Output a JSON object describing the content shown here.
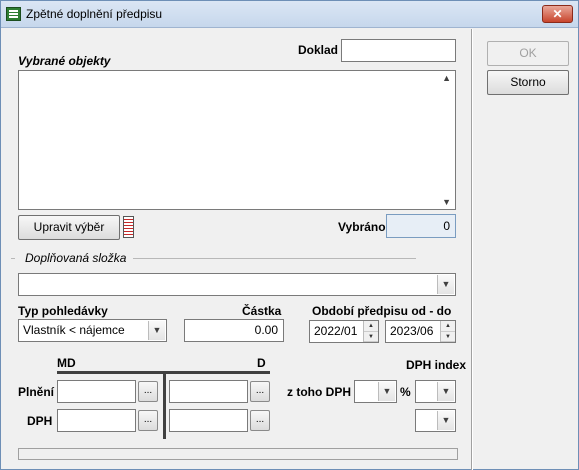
{
  "window": {
    "title": "Zpětné doplnění předpisu",
    "close_label": "✕"
  },
  "buttons": {
    "ok": "OK",
    "storno": "Storno",
    "upravit_vyber": "Upravit výběr"
  },
  "doklad": {
    "label": "Doklad",
    "value": ""
  },
  "vybrane_objekty": {
    "label": "Vybrané objekty",
    "items": []
  },
  "vybrano": {
    "label": "Vybráno",
    "value": "0"
  },
  "doplnovana_slozka": {
    "label": "Doplňovaná složka",
    "value": ""
  },
  "typ_pohledavky": {
    "label": "Typ pohledávky",
    "value": "Vlastník < nájemce"
  },
  "castka": {
    "label": "Částka",
    "value": "0.00"
  },
  "obdobi": {
    "label": "Období předpisu od - do",
    "od": "2022/01",
    "do": "2023/06"
  },
  "md_d": {
    "md_label": "MD",
    "d_label": "D",
    "plneni_label": "Plnění",
    "dph_label": "DPH",
    "dots": "..."
  },
  "dph": {
    "index_label": "DPH index",
    "z_toho_label": "z toho DPH",
    "percent": "%"
  },
  "icons": {
    "combo_arrow": "▼",
    "scroll_up": "▲",
    "scroll_down": "▼",
    "spin_up": "▲",
    "spin_down": "▼"
  }
}
